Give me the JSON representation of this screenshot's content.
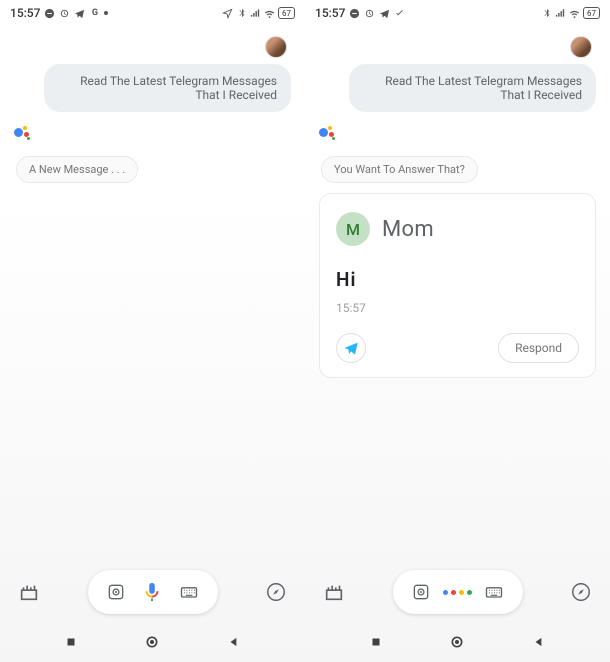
{
  "status": {
    "time": "15:57",
    "battery": "67"
  },
  "left": {
    "user_message": "Read The Latest Telegram Messages That I Received",
    "assistant_reply": "A New Message . . ."
  },
  "right": {
    "user_message": "Read The Latest Telegram Messages That I Received",
    "assistant_reply": "You Want To Answer That?",
    "card": {
      "avatar_initial": "M",
      "contact_name": "Mom",
      "message_body": "Hi",
      "message_time": "15:57",
      "respond_label": "Respond"
    }
  }
}
